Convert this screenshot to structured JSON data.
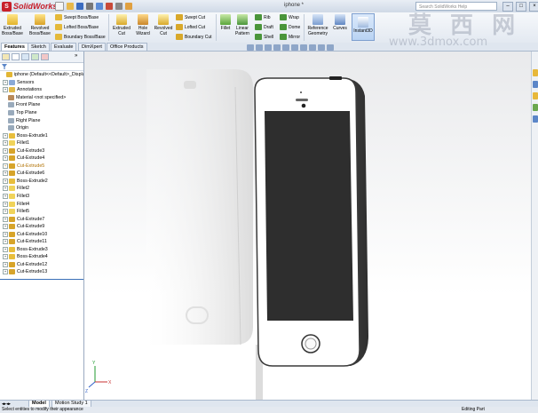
{
  "app": {
    "name": "SolidWorks",
    "doc_title": "iphone *",
    "search_placeholder": "Search SolidWorks Help"
  },
  "window_controls": [
    "–",
    "□",
    "×"
  ],
  "ribbon": {
    "extruded_boss": "Extruded Boss/Base",
    "revolved_boss": "Revolved Boss/Base",
    "swept_boss": "Swept Boss/Base",
    "lofted_boss": "Lofted Boss/Base",
    "boundary_boss": "Boundary Boss/Base",
    "extruded_cut": "Extruded Cut",
    "hole_wizard": "Hole Wizard",
    "revolved_cut": "Revolved Cut",
    "swept_cut": "Swept Cut",
    "lofted_cut": "Lofted Cut",
    "boundary_cut": "Boundary Cut",
    "fillet": "Fillet",
    "linear_pattern": "Linear Pattern",
    "rib": "Rib",
    "draft": "Draft",
    "shell": "Shell",
    "wrap": "Wrap",
    "dome": "Dome",
    "mirror": "Mirror",
    "reference_geometry": "Reference Geometry",
    "curves": "Curves",
    "instant3d": "Instant3D"
  },
  "tabs": [
    "Features",
    "Sketch",
    "Evaluate",
    "DimXpert",
    "Office Products"
  ],
  "tree": {
    "root": "iphone  (Default<<Default>_Display State 1>)",
    "items": [
      "Sensors",
      "Annotations",
      "Material <not specified>",
      "Front Plane",
      "Top Plane",
      "Right Plane",
      "Origin",
      "Boss-Extrude1",
      "Fillet1",
      "Cut-Extrude3",
      "Cut-Extrude4",
      "Cut-Extrude5",
      "Cut-Extrude6",
      "Boss-Extrude2",
      "Fillet2",
      "Fillet3",
      "Fillet4",
      "Fillet5",
      "Cut-Extrude7",
      "Cut-Extrude9",
      "Cut-Extrude10",
      "Cut-Extrude11",
      "Boss-Extrude3",
      "Boss-Extrude4",
      "Cut-Extrude12",
      "Cut-Extrude13"
    ]
  },
  "bottom_tabs": [
    "Model",
    "Motion Study 1"
  ],
  "status": {
    "left": "Select entities to modify their appearance",
    "right": "Editing Part"
  },
  "watermark": {
    "cn": "莫 西 网",
    "url": "www.3dmox.com"
  },
  "colors": {
    "accent": "#c8202b",
    "screen": "#2e2e2e",
    "body_edge": "#4a4a4a"
  }
}
